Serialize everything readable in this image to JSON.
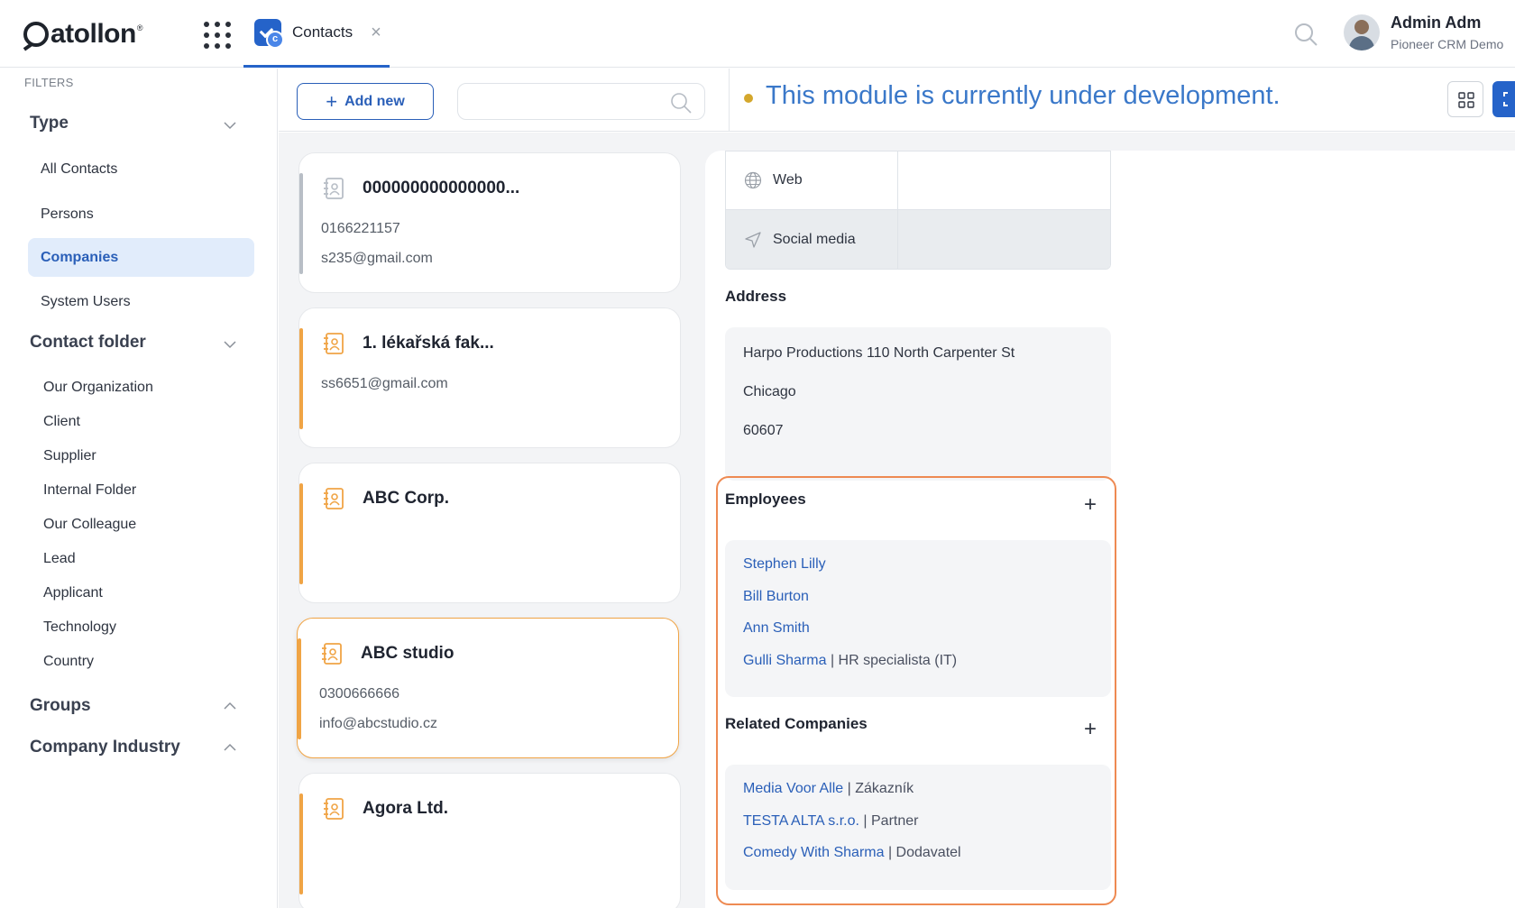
{
  "brand": {
    "name": "atollon",
    "reg": "®"
  },
  "tab": {
    "label": "Contacts",
    "close": "×"
  },
  "user": {
    "name": "Admin Adm",
    "org": "Pioneer CRM Demo"
  },
  "filters": {
    "label": "FILTERS",
    "type": {
      "title": "Type",
      "items": [
        "All Contacts",
        "Persons",
        "Companies",
        "System Users"
      ],
      "active": "Companies"
    },
    "folder": {
      "title": "Contact folder",
      "items": [
        "Our Organization",
        "Client",
        "Supplier",
        "Internal Folder",
        "Our Colleague",
        "Lead",
        "Applicant",
        "Technology",
        "Country"
      ]
    },
    "groups": {
      "title": "Groups"
    },
    "industry": {
      "title": "Company Industry"
    }
  },
  "toolbar": {
    "add_label": "Add new",
    "search_placeholder": "",
    "dev_message": "This module is currently under development."
  },
  "cards": [
    {
      "title": "000000000000000...",
      "line1": "0166221157",
      "line2": "s235@gmail.com"
    },
    {
      "title": "1. lékařská fak...",
      "line1": "ss6651@gmail.com",
      "line2": ""
    },
    {
      "title": "ABC Corp.",
      "line1": "",
      "line2": ""
    },
    {
      "title": "ABC studio",
      "line1": "0300666666",
      "line2": "info@abcstudio.cz"
    },
    {
      "title": "Agora Ltd.",
      "line1": "",
      "line2": ""
    }
  ],
  "detail": {
    "web_label": "Web",
    "web_value": "",
    "social_label": "Social media",
    "social_value": "",
    "address_title": "Address",
    "address": [
      "Harpo Productions 110 North Carpenter St",
      "Chicago",
      "60607"
    ],
    "employees_title": "Employees",
    "employees": [
      {
        "name": "Stephen Lilly",
        "meta": ""
      },
      {
        "name": "Bill Burton",
        "meta": ""
      },
      {
        "name": "Ann Smith",
        "meta": ""
      },
      {
        "name": "Gulli Sharma",
        "meta": "| HR specialista (IT)"
      }
    ],
    "related_title": "Related Companies",
    "related": [
      {
        "name": "Media Voor Alle",
        "meta": "| Zákazník"
      },
      {
        "name": "TESTA ALTA s.r.o.",
        "meta": "| Partner"
      },
      {
        "name": "Comedy With Sharma",
        "meta": "| Dodavatel"
      }
    ],
    "plus": "+"
  },
  "colors": {
    "accent": "#2563c9",
    "highlight": "#ee8a52",
    "card_bar": "#f0a445",
    "dev_dot": "#d4a72c"
  }
}
